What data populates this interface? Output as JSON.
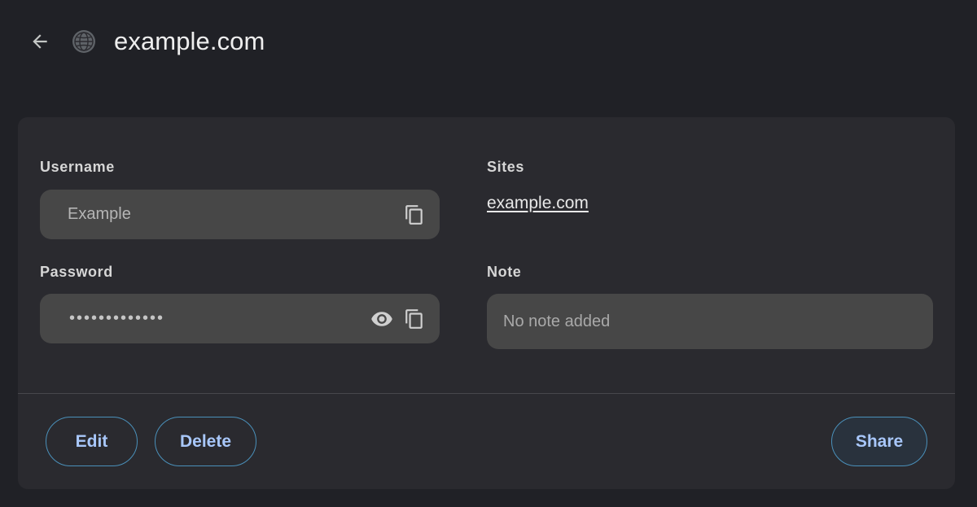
{
  "header": {
    "back_icon": "arrow-back-icon",
    "favicon_icon": "globe-icon",
    "title": "example.com"
  },
  "fields": {
    "username": {
      "label": "Username",
      "value": "Example",
      "copy_icon": "copy-icon"
    },
    "password": {
      "label": "Password",
      "value": "•••••••••••••",
      "show_icon": "eye-icon",
      "copy_icon": "copy-icon"
    },
    "sites": {
      "label": "Sites",
      "link": "example.com"
    },
    "note": {
      "label": "Note",
      "value": "No note added"
    }
  },
  "actions": {
    "edit_label": "Edit",
    "delete_label": "Delete",
    "share_label": "Share"
  },
  "colors": {
    "background": "#202126",
    "card": "#2a2a2f",
    "field": "#474747",
    "accent_border": "#4a90ba",
    "accent_text": "#a8c7fa"
  }
}
